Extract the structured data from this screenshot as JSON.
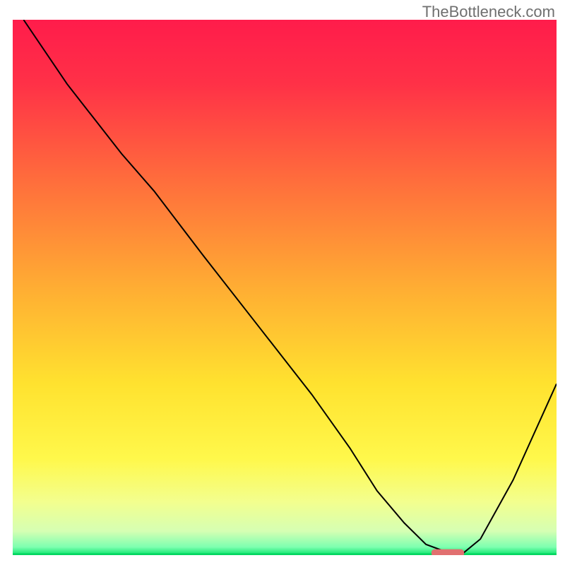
{
  "watermark": "TheBottleneck.com",
  "chart_data": {
    "type": "line",
    "title": "",
    "xlabel": "",
    "ylabel": "",
    "xlim": [
      0,
      100
    ],
    "ylim": [
      0,
      100
    ],
    "grid": false,
    "gradient": {
      "stops": [
        {
          "offset": 0.0,
          "color": "#ff1c4b"
        },
        {
          "offset": 0.12,
          "color": "#ff3147"
        },
        {
          "offset": 0.3,
          "color": "#ff6d3c"
        },
        {
          "offset": 0.5,
          "color": "#ffad33"
        },
        {
          "offset": 0.68,
          "color": "#ffe22f"
        },
        {
          "offset": 0.82,
          "color": "#fff84b"
        },
        {
          "offset": 0.9,
          "color": "#f3ff8e"
        },
        {
          "offset": 0.955,
          "color": "#d6ffb3"
        },
        {
          "offset": 0.985,
          "color": "#7dffb0"
        },
        {
          "offset": 1.0,
          "color": "#06e569"
        }
      ]
    },
    "series": [
      {
        "name": "bottleneck-curve",
        "color": "#000000",
        "x": [
          2,
          10,
          20,
          26,
          35,
          45,
          55,
          62,
          67,
          72,
          76,
          80,
          83,
          86,
          92,
          100
        ],
        "y": [
          100,
          88,
          75,
          68,
          56,
          43,
          30,
          20,
          12,
          6,
          2,
          0.5,
          0.5,
          3,
          14,
          32
        ]
      }
    ],
    "marker": {
      "name": "optimal-region",
      "color": "#e17070",
      "x_start": 77,
      "x_end": 83,
      "y": 0.4
    },
    "baseline": {
      "color": "#05d660",
      "y": 0
    }
  }
}
